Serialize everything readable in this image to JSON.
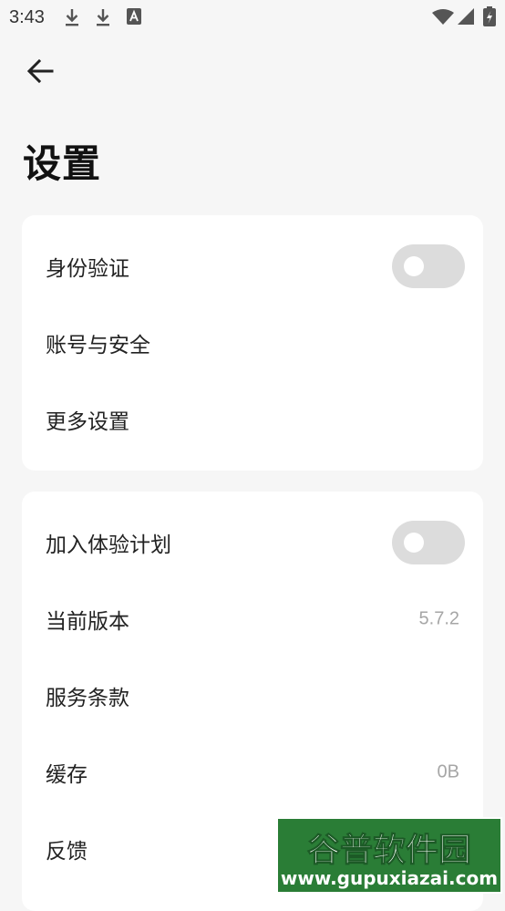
{
  "status_bar": {
    "time": "3:43",
    "icons": [
      "download-icon",
      "download-icon",
      "font-a-icon",
      "wifi-icon",
      "signal-icon",
      "battery-charging-icon"
    ]
  },
  "header": {
    "back_icon": "arrow-left-icon",
    "title": "设置"
  },
  "group_1": {
    "rows": [
      {
        "label": "身份验证",
        "control": "toggle",
        "on": false
      },
      {
        "label": "账号与安全"
      },
      {
        "label": "更多设置"
      }
    ]
  },
  "group_2": {
    "rows": [
      {
        "label": "加入体验计划",
        "control": "toggle",
        "on": false
      },
      {
        "label": "当前版本",
        "value": "5.7.2"
      },
      {
        "label": "服务条款"
      },
      {
        "label": "缓存",
        "value": "0B"
      },
      {
        "label": "反馈"
      }
    ]
  },
  "watermark": {
    "title": "谷普软件园",
    "url": "www.gupuxiazai.com"
  },
  "colors": {
    "background": "#f6f6f6",
    "card": "#ffffff",
    "toggle_off": "#dcdcdc",
    "secondary_text": "#a6a6a6",
    "watermark_green": "#2a7d36"
  }
}
